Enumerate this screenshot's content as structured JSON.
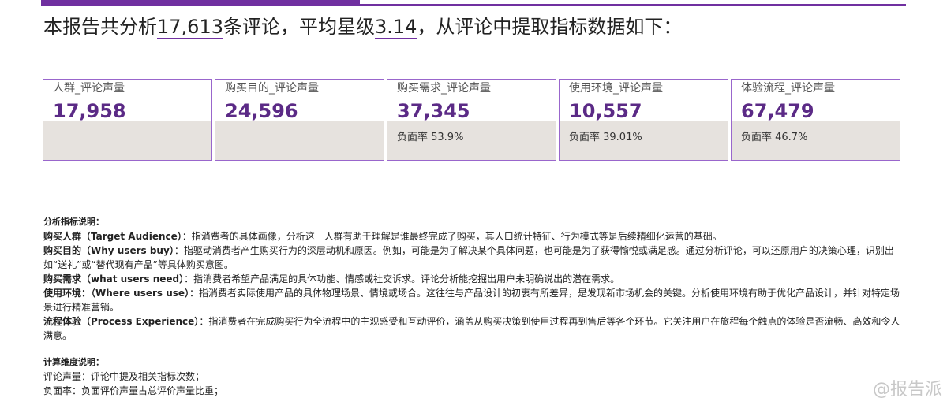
{
  "header": {
    "text_prefix": "本报告共分析",
    "review_count": "17,613",
    "text_mid": "条评论，平均星级",
    "avg_rating": "3.14",
    "text_suffix": "，从评论中提取指标数据如下："
  },
  "cards": [
    {
      "label": "人群_评论声量",
      "value": "17,958",
      "rate": ""
    },
    {
      "label": "购买目的_评论声量",
      "value": "24,596",
      "rate": ""
    },
    {
      "label": "购买需求_评论声量",
      "value": "37,345",
      "rate": "负面率 53.9%"
    },
    {
      "label": "使用环境_评论声量",
      "value": "10,557",
      "rate": "负面率 39.01%"
    },
    {
      "label": "体验流程_评论声量",
      "value": "67,479",
      "rate": "负面率 46.7%"
    }
  ],
  "notes": {
    "title": "分析指标说明：",
    "items": [
      {
        "term": "购买人群（Target Audience）",
        "desc": "：指消费者的具体画像，分析这一人群有助于理解是谁最终完成了购买，其人口统计特征、行为模式等是后续精细化运营的基础。"
      },
      {
        "term": "购买目的（Why users buy）",
        "desc": "：指驱动消费者产生购买行为的深层动机和原因。例如，可能是为了解决某个具体问题，也可能是为了获得愉悦或满足感。通过分析评论，可以还原用户的决策心理，识别出如“送礼”或“替代现有产品”等具体购买意图。"
      },
      {
        "term": "购买需求（what users need）",
        "desc": "：指消费者希望产品满足的具体功能、情感或社交诉求。评论分析能挖掘出用户未明确说出的潜在需求。"
      },
      {
        "term": "使用环境：（Where users use）",
        "desc": "：指消费者实际使用产品的具体物理场景、情境或场合。这往往与产品设计的初衷有所差异，是发现新市场机会的关键。分析使用环境有助于优化产品设计，并针对特定场景进行精准营销。"
      },
      {
        "term": "流程体验（Process Experience）",
        "desc": "：指消费者在完成购买行为全流程中的主观感受和互动评价，涵盖从购买决策到使用过程再到售后等各个环节。它关注用户在旅程每个触点的体验是否流畅、高效和令人满意。"
      }
    ]
  },
  "calc": {
    "title": "计算维度说明：",
    "lines": [
      "评论声量：评论中提及相关指标次数；",
      "负面率：负面评价声量占总评价声量比重；"
    ]
  },
  "watermark": "@报告派",
  "colors": {
    "accent": "#7030a0",
    "value": "#5b2a86",
    "card_fill": "#e6e2de",
    "card_border": "#9966cc"
  }
}
